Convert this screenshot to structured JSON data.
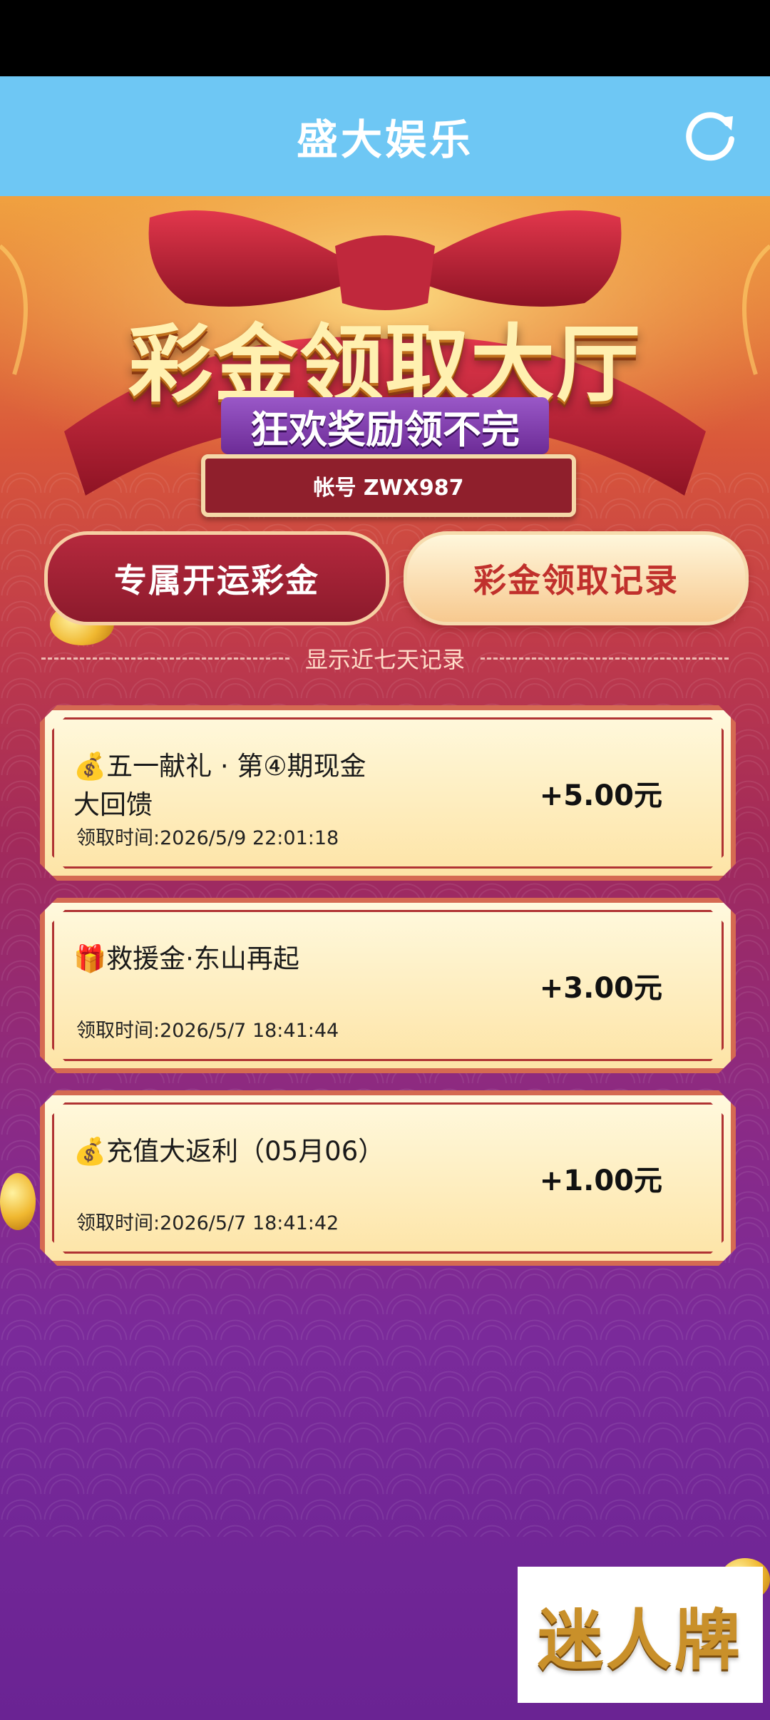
{
  "header": {
    "title": "盛大娱乐",
    "refresh_icon": "refresh-icon"
  },
  "banner": {
    "title": "彩金领取大厅",
    "subtitle": "狂欢奖励领不完",
    "account": "帐号 ZWX987"
  },
  "tabs": [
    {
      "label": "专属开运彩金",
      "active": false
    },
    {
      "label": "彩金领取记录",
      "active": true
    }
  ],
  "divider_label": "显示近七天记录",
  "records": [
    {
      "icon": "money-bag-icon",
      "title": "💰五一献礼 · 第④期现金大回馈",
      "time": "领取时间:2026/5/9 22:01:18",
      "amount": "+5.00元"
    },
    {
      "icon": "gift-icon",
      "title": "🎁救援金·东山再起",
      "time": "领取时间:2026/5/7 18:41:44",
      "amount": "+3.00元"
    },
    {
      "icon": "money-bag-icon",
      "title": "💰充值大返利（05月06）",
      "time": "领取时间:2026/5/7 18:41:42",
      "amount": "+1.00元"
    }
  ],
  "watermark": "迷人牌",
  "colors": {
    "title_bar": "#6ec7f4",
    "tab_active_text": "#c0302c",
    "tab_inactive_bg": "#9e2234",
    "card_bg": "#fdeab8"
  }
}
